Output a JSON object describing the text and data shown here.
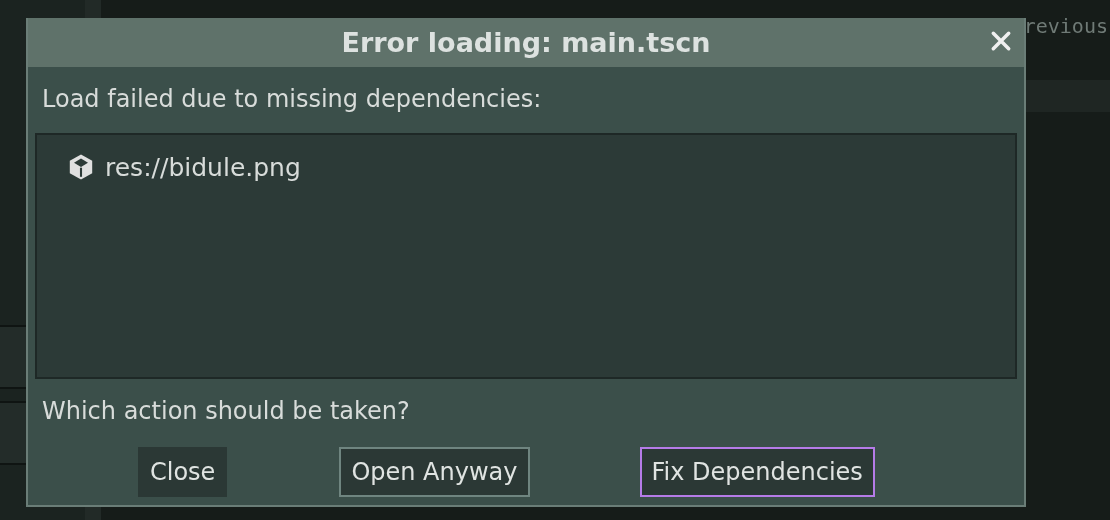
{
  "background": {
    "code_text": "revious"
  },
  "dialog": {
    "title": "Error loading: main.tscn",
    "message": "Load failed due to missing dependencies:",
    "dependencies": [
      {
        "path": "res://bidule.png"
      }
    ],
    "question": "Which action should be taken?",
    "buttons": [
      {
        "label": "Close",
        "focused": false,
        "kind": "plain"
      },
      {
        "label": "Open Anyway",
        "focused": false,
        "kind": "outlined"
      },
      {
        "label": "Fix Dependencies",
        "focused": true,
        "kind": "outlined"
      }
    ]
  }
}
